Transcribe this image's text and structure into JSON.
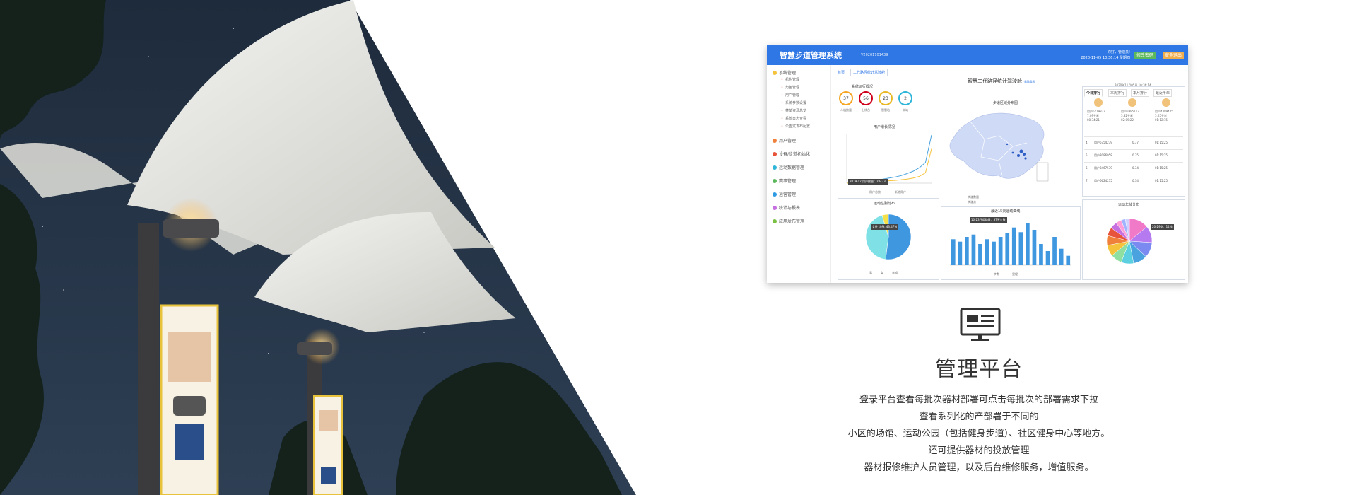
{
  "dashboard": {
    "system_title": "智慧步道管理系统",
    "version": "V20201101439",
    "welcome": "你好，管理员!",
    "datetime": "2020-11-05 10:36:14 星期四",
    "btn_change_password": "修改密码",
    "btn_logout": "安全退出",
    "tabs": [
      "首页",
      "二代路径统计驾驶舱"
    ],
    "menu": [
      {
        "label": "系统管理",
        "color": "#f5c33b",
        "children": [
          "机构管理",
          "角色管理",
          "用户管理",
          "系统参数设置",
          "菜单资源总览",
          "系统日志查看",
          "公告式发布配置"
        ]
      },
      {
        "label": "用户管理",
        "color": "#f0813b"
      },
      {
        "label": "设备/步道初始化",
        "color": "#e8543b"
      },
      {
        "label": "运动数据管理",
        "color": "#2fb5d8"
      },
      {
        "label": "赛事管理",
        "color": "#5cb85c"
      },
      {
        "label": "运营管理",
        "color": "#2f9ae4"
      },
      {
        "label": "统计与报表",
        "color": "#c56fe0"
      },
      {
        "label": "应用发布管理",
        "color": "#7ac143"
      }
    ],
    "main_title": "智慧二代路径统计驾驶舱",
    "main_title_link": "全屏展示",
    "timestamp": "2020年11月05日 10:36:14",
    "overview": {
      "title": "系统运行概况",
      "gauges": [
        {
          "value": "37",
          "label": "人机数量",
          "color": "#f5a623"
        },
        {
          "value": "56",
          "label": "上线台",
          "color": "#d0021b"
        },
        {
          "value": "23",
          "label": "智慧站",
          "color": "#e8b923"
        },
        {
          "value": "2",
          "label": "未站",
          "color": "#2fb5d8"
        }
      ]
    },
    "user_growth": {
      "title": "用户增长情况",
      "tooltip": "2019-12 用户数量：2847人",
      "legend": [
        "用户总数",
        "新增用户"
      ]
    },
    "map": {
      "title": "步道区域分布图",
      "legend": [
        "步道数量",
        "步道点"
      ]
    },
    "ranking": {
      "tabs": [
        "今日排行",
        "本周排行",
        "本月排行",
        "最近半年"
      ],
      "top3": [
        {
          "name": "用户6719827",
          "distance": "7.09千米",
          "time": "08:34:21"
        },
        {
          "name": "用户5995113",
          "distance": "5.82千米",
          "time": "02:09:22"
        },
        {
          "name": "用户4389475",
          "distance": "5.25千米",
          "time": "01:12:15"
        }
      ],
      "rows": [
        {
          "rank": "4.",
          "name": "用户6754239",
          "distance": "0.37",
          "time": "01:15:25"
        },
        {
          "rank": "5.",
          "name": "用户8086958",
          "distance": "0.35",
          "time": "01:15:25"
        },
        {
          "rank": "6.",
          "name": "用户8467539",
          "distance": "0.34",
          "time": "01:15:25"
        },
        {
          "rank": "7.",
          "name": "用户6624215",
          "distance": "0.34",
          "time": "01:15:25"
        }
      ]
    },
    "gender": {
      "title": "运动性别分布",
      "tooltip": "女性 比例: 43.47%",
      "legend": [
        "男",
        "女",
        "未知"
      ]
    },
    "trend": {
      "title": "最近15天运动曲线",
      "tooltip": "10-23日运动量：37天步数",
      "legend": [
        "步数",
        "里程"
      ]
    },
    "age": {
      "title": "运动年龄分布",
      "tooltip": "20-29岁：14%"
    }
  },
  "chart_data": [
    {
      "type": "line",
      "title": "用户增长情况",
      "series": [
        {
          "name": "用户总数",
          "values": [
            0,
            2,
            4,
            6,
            8,
            10,
            12,
            15,
            18,
            22,
            28,
            35,
            45,
            60,
            140
          ]
        },
        {
          "name": "新增用户",
          "values": [
            0,
            1,
            2,
            3,
            4,
            5,
            6,
            7,
            8,
            10,
            12,
            15,
            20,
            30,
            100
          ]
        }
      ]
    },
    {
      "type": "pie",
      "title": "运动性别分布",
      "categories": [
        "男",
        "女",
        "未知"
      ],
      "values": [
        52,
        43.47,
        4.53
      ]
    },
    {
      "type": "bar",
      "title": "最近15天运动曲线",
      "series": [
        {
          "name": "步数",
          "values": [
            22,
            20,
            24,
            26,
            18,
            22,
            20,
            24,
            27,
            32,
            28,
            36,
            30,
            18,
            12,
            24,
            14,
            8
          ]
        }
      ]
    },
    {
      "type": "pie",
      "title": "运动年龄分布",
      "values": [
        14,
        12,
        11,
        10,
        9,
        8,
        8,
        7,
        6,
        5,
        4,
        3,
        3
      ]
    }
  ],
  "caption": {
    "heading": "管理平台",
    "lines": [
      "登录平台查看每批次器材部署可点击每批次的部署需求下拉",
      "查看系列化的产部署于不同的",
      "小区的场馆、运动公园（包括健身步道）、社区健身中心等地方。",
      "还可提供器材的投放管理",
      "器材报修维护人员管理，以及后台维修服务，增值服务。"
    ]
  }
}
